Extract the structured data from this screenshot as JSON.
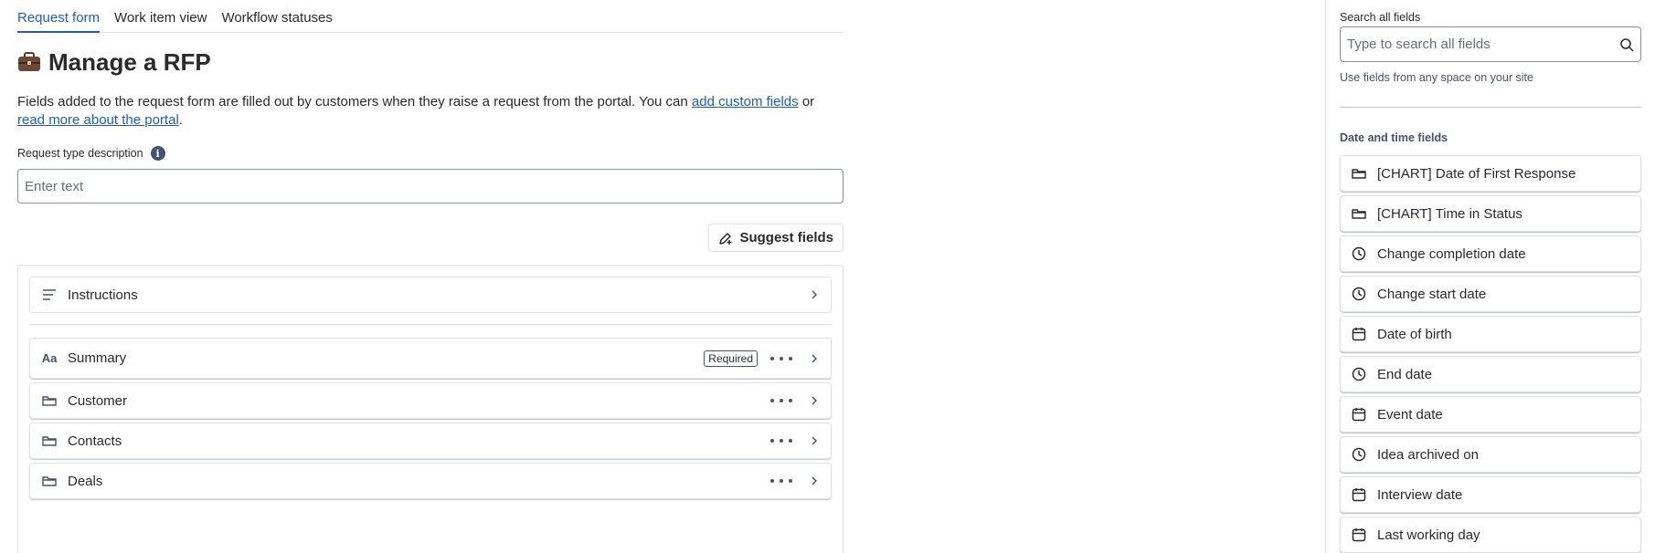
{
  "tabs": [
    {
      "label": "Request form",
      "active": true
    },
    {
      "label": "Work item view",
      "active": false
    },
    {
      "label": "Workflow statuses",
      "active": false
    }
  ],
  "page": {
    "title": "Manage a RFP",
    "title_icon": "briefcase-icon",
    "description_pre": "Fields added to the request form are filled out by customers when they raise a request from the portal. You can ",
    "link_custom_fields": "add custom fields",
    "description_mid": " or ",
    "link_portal": "read more about the portal",
    "description_post": "."
  },
  "request_type": {
    "label": "Request type description",
    "placeholder": "Enter text"
  },
  "suggest_button": "Suggest fields",
  "form_fields": {
    "instructions": {
      "label": "Instructions",
      "icon": "lines-icon"
    },
    "fields": [
      {
        "label": "Summary",
        "icon": "text-type-icon",
        "badge": "Required"
      },
      {
        "label": "Customer",
        "icon": "folder-icon"
      },
      {
        "label": "Contacts",
        "icon": "folder-icon"
      },
      {
        "label": "Deals",
        "icon": "folder-icon"
      }
    ]
  },
  "sidebar": {
    "search_label": "Search all fields",
    "search_placeholder": "Type to search all fields",
    "search_help": "Use fields from any space on your site",
    "group_title": "Date and time fields",
    "items": [
      {
        "label": "[CHART] Date of First Response",
        "icon": "folder-icon"
      },
      {
        "label": "[CHART] Time in Status",
        "icon": "folder-icon"
      },
      {
        "label": "Change completion date",
        "icon": "clock-icon"
      },
      {
        "label": "Change start date",
        "icon": "clock-icon"
      },
      {
        "label": "Date of birth",
        "icon": "calendar-icon"
      },
      {
        "label": "End date",
        "icon": "clock-icon"
      },
      {
        "label": "Event date",
        "icon": "calendar-icon"
      },
      {
        "label": "Idea archived on",
        "icon": "clock-icon"
      },
      {
        "label": "Interview date",
        "icon": "calendar-icon"
      },
      {
        "label": "Last working day",
        "icon": "calendar-icon"
      }
    ]
  },
  "colors": {
    "accent": "#1d5bd6",
    "text": "#292a2e",
    "border": "#dfe1e6"
  }
}
